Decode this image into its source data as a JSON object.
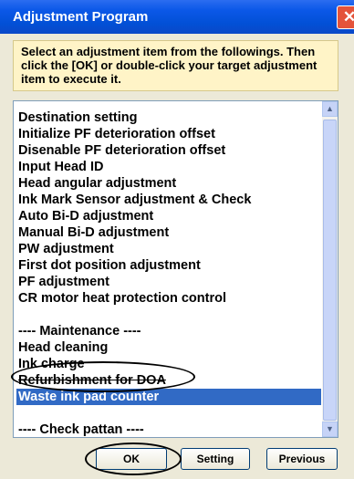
{
  "window": {
    "title": "Adjustment Program",
    "close_glyph": "✕"
  },
  "instructions": "Select an adjustment item from the followings. Then click the [OK] or double-click your target adjustment item to execute it.",
  "list": {
    "items": [
      {
        "label": "Destination setting"
      },
      {
        "label": "Initialize PF deterioration offset"
      },
      {
        "label": "Disenable PF deterioration offset"
      },
      {
        "label": "Input Head ID"
      },
      {
        "label": "Head angular adjustment"
      },
      {
        "label": "Ink Mark Sensor adjustment & Check"
      },
      {
        "label": "Auto Bi-D adjustment"
      },
      {
        "label": "Manual Bi-D adjustment"
      },
      {
        "label": "PW adjustment"
      },
      {
        "label": "First dot position adjustment"
      },
      {
        "label": "PF adjustment"
      },
      {
        "label": "CR motor heat protection control"
      },
      {
        "label": ""
      },
      {
        "label": "---- Maintenance ----"
      },
      {
        "label": "Head cleaning"
      },
      {
        "label": "Ink charge"
      },
      {
        "label": "Refurbishment for DOA"
      },
      {
        "label": "Waste ink pad counter",
        "selected": true
      },
      {
        "label": ""
      },
      {
        "label": "---- Check pattan ----"
      }
    ]
  },
  "buttons": {
    "ok": "OK",
    "setting": "Setting",
    "previous": "Previous"
  },
  "colors": {
    "titlebar": "#0250d6",
    "selection": "#316ac5",
    "instructions_bg": "#fff4c7",
    "dialog_bg": "#ece9d8"
  }
}
